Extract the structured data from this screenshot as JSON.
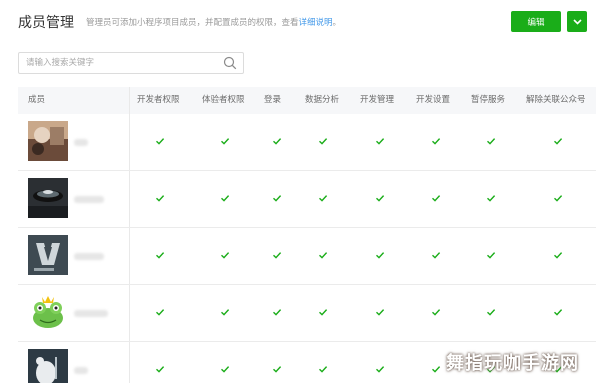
{
  "header": {
    "title": "成员管理",
    "desc_prefix": "管理员可添加小程序项目成员，并配置成员的权限，查看",
    "desc_link": "详细说明",
    "desc_suffix": "。",
    "edit_label": "编辑"
  },
  "search": {
    "placeholder": "请输入搜索关键字"
  },
  "table": {
    "columns": [
      "成员",
      "开发者权限",
      "体验者权限",
      "登录",
      "数据分析",
      "开发管理",
      "开发设置",
      "暂停服务",
      "解除关联公众号"
    ],
    "rows": [
      {
        "avatar": "photo-avatar",
        "name": "",
        "perms": [
          true,
          true,
          true,
          true,
          true,
          true,
          true,
          true
        ]
      },
      {
        "avatar": "dark-device-avatar",
        "name": "",
        "perms": [
          true,
          true,
          true,
          true,
          true,
          true,
          true,
          true
        ]
      },
      {
        "avatar": "logo-avatar",
        "name": "",
        "perms": [
          true,
          true,
          true,
          true,
          true,
          true,
          true,
          true
        ]
      },
      {
        "avatar": "frog-avatar",
        "name": "",
        "perms": [
          true,
          true,
          true,
          true,
          true,
          true,
          true,
          true
        ]
      },
      {
        "avatar": "bear-avatar",
        "name": "",
        "perms": [
          true,
          true,
          true,
          true,
          true,
          true,
          true,
          true
        ]
      }
    ]
  },
  "watermark": "舞指玩咖手游网",
  "colors": {
    "accent": "#1aad19",
    "link": "#459ae9",
    "check": "#1aad19"
  }
}
